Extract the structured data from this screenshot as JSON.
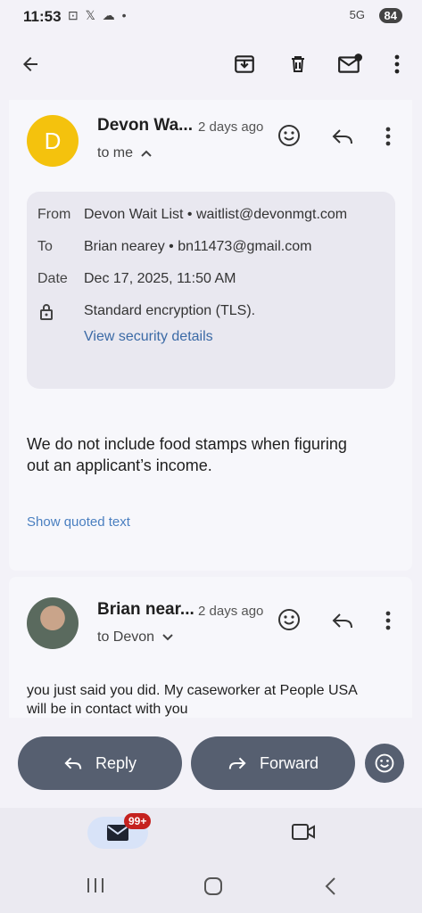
{
  "status": {
    "time": "11:53",
    "icons": "⊡ 𝕏 ☁ •",
    "network": "5G",
    "battery": "84"
  },
  "toolbar": {
    "back": "back-arrow",
    "archive": "archive",
    "delete": "delete",
    "mark_unread": "mark-unread",
    "more": "more"
  },
  "message1": {
    "avatar_letter": "D",
    "avatar_color": "#f4c20d",
    "sender": "Devon Wa...",
    "when": "2 days ago",
    "to": "to me",
    "details": {
      "from_label": "From",
      "from_value": "Devon Wait List • waitlist@devonmgt.com",
      "to_label": "To",
      "to_value": "Brian nearey • bn11473@gmail.com",
      "date_label": "Date",
      "date_value": "Dec 17, 2025, 11:50 AM",
      "encryption": "Standard encryption (TLS).",
      "security_link": "View security details"
    },
    "body_line1": "We do not include food stamps when figuring",
    "body_line2": "out an applicant’s income.",
    "show_quoted": "Show quoted text"
  },
  "message2": {
    "sender": "Brian near...",
    "when": "2 days ago",
    "to": "to Devon",
    "body_line1": "you just said you did. My caseworker at People USA",
    "body_line2": "will be in contact with you"
  },
  "actions": {
    "reply": "Reply",
    "forward": "Forward"
  },
  "bottom_nav": {
    "mail_badge": "99+"
  }
}
